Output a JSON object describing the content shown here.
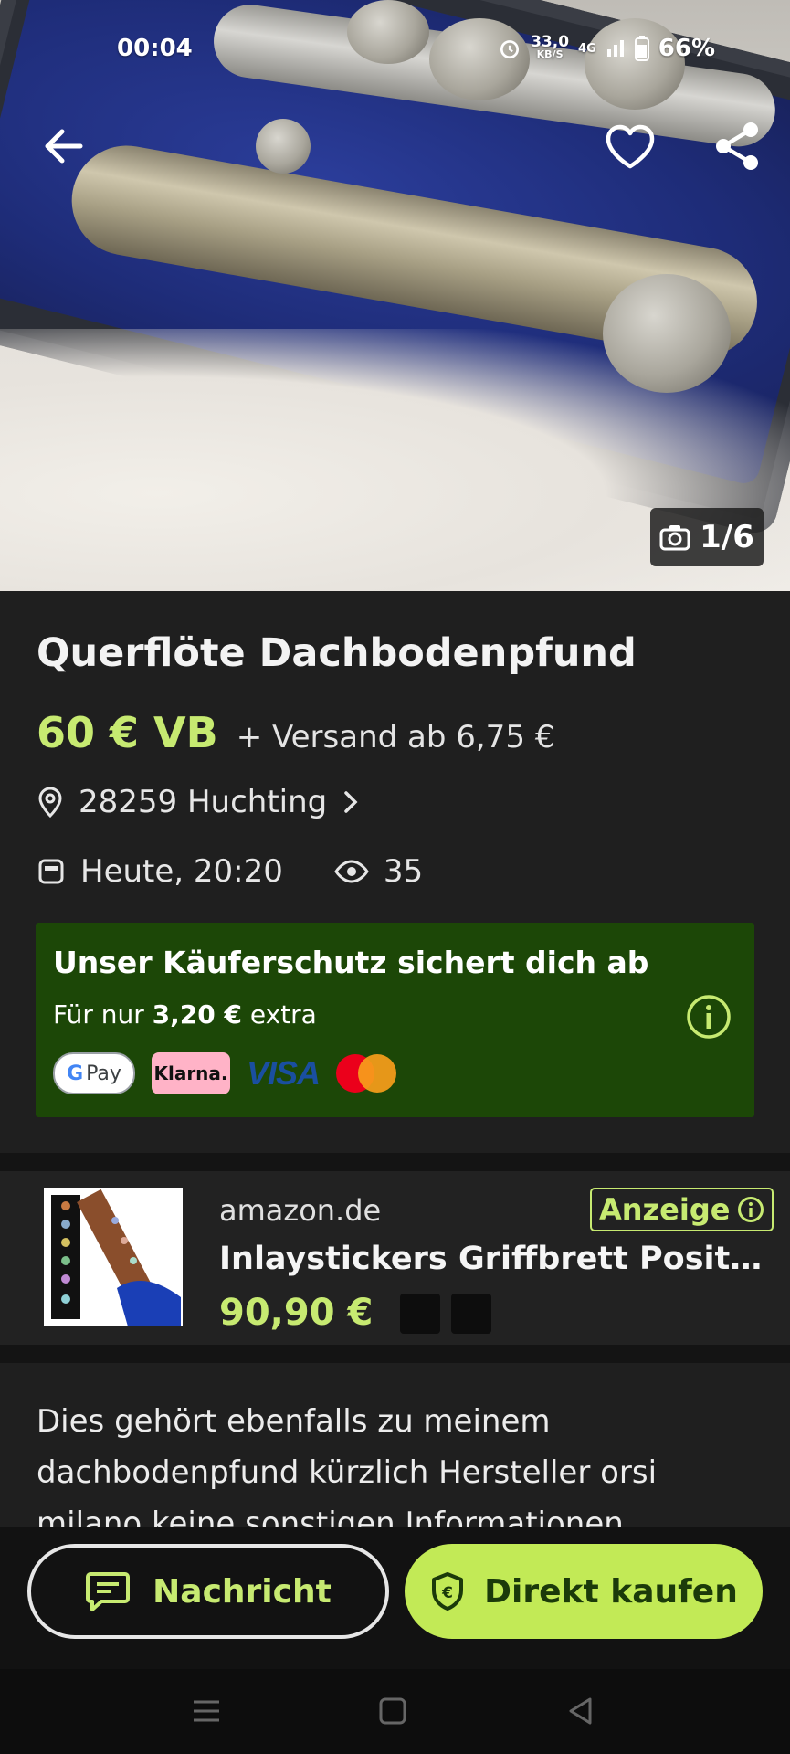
{
  "status_bar": {
    "time": "00:04",
    "net_speed_value": "33,0",
    "net_speed_unit": "KB/S",
    "network": "4G",
    "battery": "66%"
  },
  "gallery": {
    "counter": "1/6"
  },
  "listing": {
    "title": "Querflöte Dachbodenpfund",
    "price": "60 € VB",
    "shipping": "+ Versand ab 6,75 €",
    "location": "28259 Huchting",
    "date": "Heute, 20:20",
    "views": "35"
  },
  "buyer_protection": {
    "title": "Unser Käuferschutz sichert dich ab",
    "sub_prefix": "Für nur",
    "sub_amount": "3,20 €",
    "sub_suffix": "extra",
    "payments": {
      "gpay": "Pay",
      "klarna": "Klarna.",
      "visa": "VISA"
    }
  },
  "ad": {
    "source": "amazon.de",
    "badge": "Anzeige",
    "title": "Inlaystickers Griffbrett Position Markers",
    "price": "90,90 €"
  },
  "description": "Dies gehört ebenfalls zu meinem dachbodenpfund kürzlich Hersteller orsi milano keine sonstigen Informationen",
  "actions": {
    "message": "Nachricht",
    "buy": "Direkt kaufen"
  },
  "colors": {
    "accent": "#c7ea71",
    "buy_button": "#c2ea56",
    "protection_bg": "#1c4707",
    "background": "#1f1f1f"
  }
}
